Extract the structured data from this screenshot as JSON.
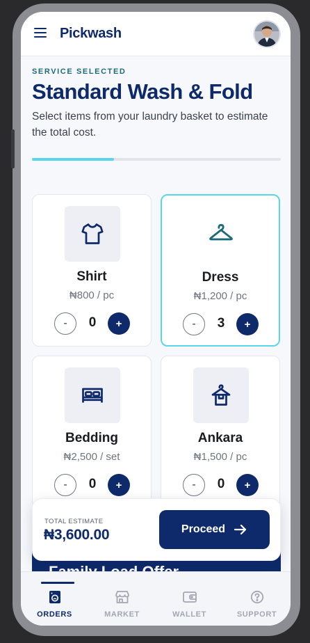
{
  "app": {
    "brand": "Pickwash"
  },
  "header": {
    "eyebrow": "SERVICE SELECTED",
    "title": "Standard Wash & Fold",
    "subtitle": "Select items from your laundry basket to estimate the total cost."
  },
  "progress": {
    "fraction": 0.33
  },
  "items": [
    {
      "name": "Shirt",
      "price": "₦800 / pc",
      "qty": "0",
      "icon": "shirt-icon",
      "selected": false
    },
    {
      "name": "Dress",
      "price": "₦1,200 / pc",
      "qty": "3",
      "icon": "hanger-icon",
      "selected": true
    },
    {
      "name": "Bedding",
      "price": "₦2,500 / set",
      "qty": "0",
      "icon": "bed-icon",
      "selected": false
    },
    {
      "name": "Ankara",
      "price": "₦1,500 / pc",
      "qty": "0",
      "icon": "garment-hanger-icon",
      "selected": false
    }
  ],
  "stepper": {
    "minus": "-",
    "plus": "+"
  },
  "estimate": {
    "label": "TOTAL ESTIMATE",
    "value": "₦3,600.00",
    "button": "Proceed"
  },
  "promo": {
    "title": "Family Load Offer"
  },
  "nav": [
    {
      "label": "ORDERS",
      "icon": "orders-icon",
      "active": true
    },
    {
      "label": "MARKET",
      "icon": "market-icon",
      "active": false
    },
    {
      "label": "WALLET",
      "icon": "wallet-icon",
      "active": false
    },
    {
      "label": "SUPPORT",
      "icon": "support-icon",
      "active": false
    }
  ],
  "colors": {
    "primary": "#0e2a6b",
    "accent": "#5ad6ea",
    "teal": "#1c6b7a"
  }
}
